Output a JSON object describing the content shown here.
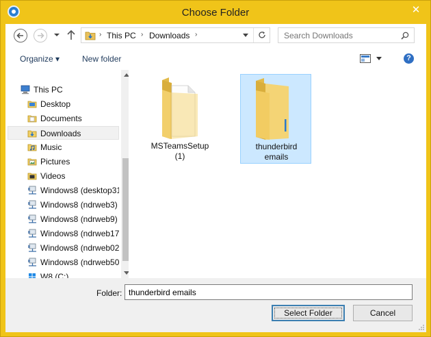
{
  "window": {
    "title": "Choose Folder",
    "close_glyph": "✕",
    "frame_color": "#f0c419"
  },
  "address_bar": {
    "breadcrumbs": [
      "This PC",
      "Downloads"
    ],
    "separator": "›",
    "search_placeholder": "Search Downloads"
  },
  "toolbar": {
    "organize_label": "Organize ▾",
    "new_folder_label": "New folder",
    "help_glyph": "?"
  },
  "nav_pane": {
    "items": [
      {
        "label": "This PC",
        "icon": "computer-icon",
        "level": 0,
        "selected": false
      },
      {
        "label": "Desktop",
        "icon": "folder-icon",
        "level": 1,
        "selected": false
      },
      {
        "label": "Documents",
        "icon": "folder-icon",
        "level": 1,
        "selected": false
      },
      {
        "label": "Downloads",
        "icon": "downloads-folder-icon",
        "level": 1,
        "selected": true
      },
      {
        "label": "Music",
        "icon": "music-folder-icon",
        "level": 1,
        "selected": false
      },
      {
        "label": "Pictures",
        "icon": "pictures-folder-icon",
        "level": 1,
        "selected": false
      },
      {
        "label": "Videos",
        "icon": "videos-folder-icon",
        "level": 1,
        "selected": false
      },
      {
        "label": "Windows8 (desktop31",
        "icon": "network-drive-icon",
        "level": 1,
        "selected": false
      },
      {
        "label": "Windows8 (ndrweb3)",
        "icon": "network-drive-icon",
        "level": 1,
        "selected": false
      },
      {
        "label": "Windows8 (ndrweb9)",
        "icon": "network-drive-icon",
        "level": 1,
        "selected": false
      },
      {
        "label": "Windows8 (ndrweb17",
        "icon": "network-drive-icon",
        "level": 1,
        "selected": false
      },
      {
        "label": "Windows8 (ndrweb02",
        "icon": "network-drive-icon",
        "level": 1,
        "selected": false
      },
      {
        "label": "Windows8 (ndrweb50",
        "icon": "network-drive-icon",
        "level": 1,
        "selected": false
      },
      {
        "label": "W8 (C:)",
        "icon": "windows-drive-icon",
        "level": 1,
        "selected": false
      }
    ]
  },
  "files": [
    {
      "label_line1": "MSTeamsSetup",
      "label_line2": "(1)",
      "icon": "folder-with-document-icon",
      "selected": false
    },
    {
      "label_line1": "thunderbird",
      "label_line2": "emails",
      "icon": "folder-icon",
      "selected": true
    }
  ],
  "bottom": {
    "folder_label": "Folder:",
    "folder_value": "thunderbird emails",
    "select_button": "Select Folder",
    "cancel_button": "Cancel"
  }
}
